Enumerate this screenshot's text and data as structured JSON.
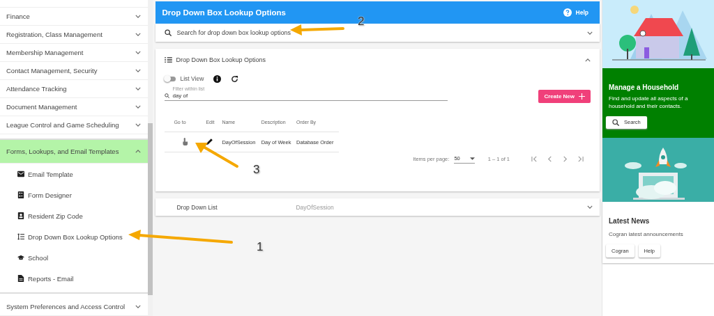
{
  "sidebar": {
    "sections": [
      {
        "label": "Finance",
        "expanded": false
      },
      {
        "label": "Registration, Class Management",
        "expanded": false
      },
      {
        "label": "Membership Management",
        "expanded": false
      },
      {
        "label": "Contact Management, Security",
        "expanded": false
      },
      {
        "label": "Attendance Tracking",
        "expanded": false
      },
      {
        "label": "Document Management",
        "expanded": false
      },
      {
        "label": "League Control and Game Scheduling",
        "expanded": false
      },
      {
        "label": "Forms, Lookups, and Email Templates",
        "expanded": true,
        "children": [
          {
            "label": "Email Template"
          },
          {
            "label": "Form Designer"
          },
          {
            "label": "Resident Zip Code"
          },
          {
            "label": "Drop Down Box Lookup Options"
          },
          {
            "label": "School"
          },
          {
            "label": "Reports - Email"
          }
        ]
      },
      {
        "label": "System Preferences and Access Control",
        "expanded": false
      }
    ]
  },
  "header": {
    "title": "Drop Down Box Lookup Options",
    "help": "Help"
  },
  "search_panel": {
    "placeholder": "Search for drop down box lookup options",
    "expanded": false
  },
  "options_panel": {
    "title": "Drop Down Box Lookup Options",
    "expanded": true,
    "list_view": {
      "label": "List View",
      "on": false
    },
    "filter": {
      "label": "Filter within list",
      "value": "day of"
    },
    "create_button": "Create New",
    "table": {
      "columns": [
        "Go to",
        "Edit",
        "Name",
        "Description",
        "Order By"
      ],
      "rows": [
        {
          "name": "DayOfSession",
          "description": "Day of Week",
          "order_by": "Database Order"
        }
      ]
    },
    "paginator": {
      "items_per_page_label": "Items per page:",
      "page_size": "50",
      "range": "1 – 1 of 1"
    }
  },
  "drop_down_list_panel": {
    "label": "Drop Down List",
    "value": "DayOfSession",
    "expanded": false
  },
  "household_card": {
    "title": "Manage a Household",
    "text": "Find and update all aspects of a household and their contacts.",
    "button": "Search"
  },
  "news_card": {
    "title": "Latest News",
    "text": "Cogran latest announcements",
    "buttons": [
      "Cogran",
      "Help"
    ]
  },
  "annotations": [
    {
      "number": "1"
    },
    {
      "number": "2"
    },
    {
      "number": "3"
    }
  ]
}
